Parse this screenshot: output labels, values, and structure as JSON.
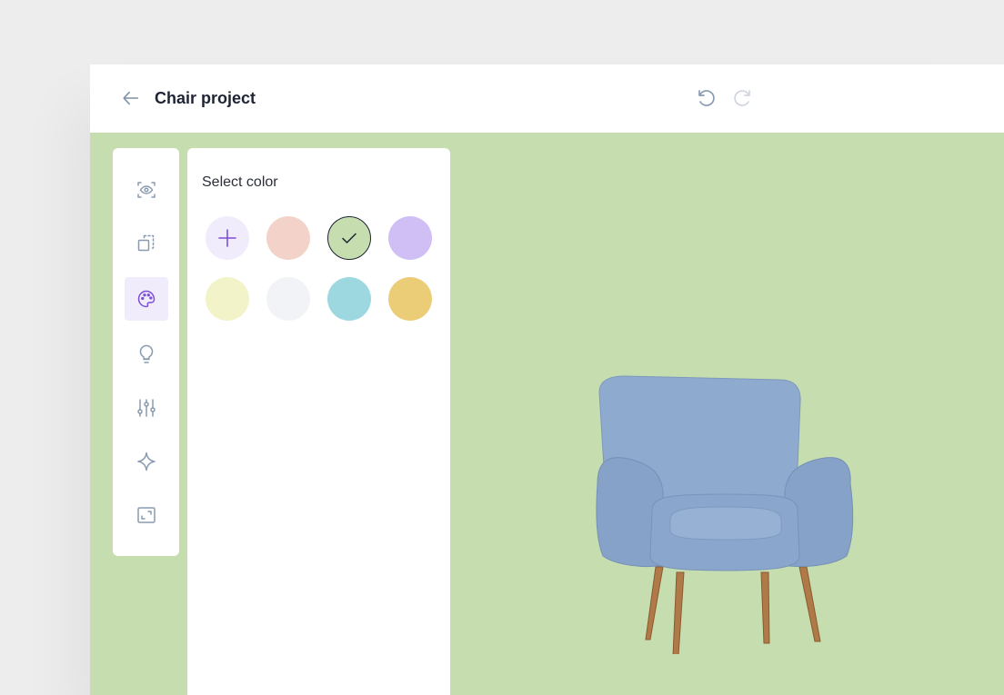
{
  "header": {
    "title": "Chair project",
    "back_icon": "arrow-left-icon",
    "undo_icon": "undo-icon",
    "redo_icon": "redo-icon"
  },
  "toolbar": {
    "items": [
      {
        "name": "preview",
        "icon": "eye-icon",
        "active": false
      },
      {
        "name": "resize",
        "icon": "crop-icon",
        "active": false
      },
      {
        "name": "color",
        "icon": "palette-icon",
        "active": true
      },
      {
        "name": "lighting",
        "icon": "lightbulb-icon",
        "active": false
      },
      {
        "name": "adjust",
        "icon": "sliders-icon",
        "active": false
      },
      {
        "name": "effects",
        "icon": "sparkle-icon",
        "active": false
      },
      {
        "name": "fullscreen",
        "icon": "expand-icon",
        "active": false
      }
    ]
  },
  "color_panel": {
    "title": "Select color",
    "add_icon": "plus-icon",
    "swatches": [
      {
        "color": "#f3d2c9",
        "selected": false
      },
      {
        "color": "#c6deaf",
        "selected": true
      },
      {
        "color": "#cfbff5",
        "selected": false
      },
      {
        "color": "#f2f3c9",
        "selected": false
      },
      {
        "color": "#f2f3f6",
        "selected": false
      },
      {
        "color": "#9dd8e1",
        "selected": false
      },
      {
        "color": "#ebcd78",
        "selected": false
      }
    ]
  },
  "canvas": {
    "background": "#c6deaf",
    "object": "armchair"
  },
  "colors": {
    "accent": "#7c4fd6",
    "icon": "#8a9bb0"
  }
}
